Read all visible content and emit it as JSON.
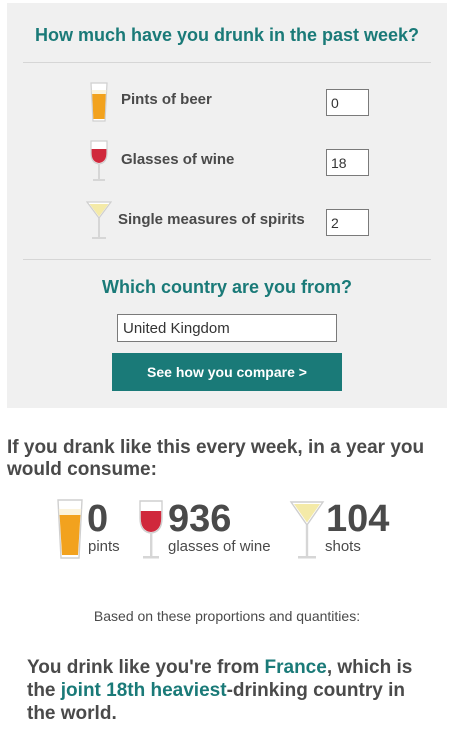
{
  "form": {
    "title": "How much have you drunk in the past week?",
    "rows": [
      {
        "icon": "beer-glass-icon",
        "label": "Pints of beer",
        "value": "0"
      },
      {
        "icon": "wine-glass-icon",
        "label": "Glasses of wine",
        "value": "18"
      },
      {
        "icon": "spirits-glass-icon",
        "label": "Single measures of spirits",
        "value": "2"
      }
    ],
    "country_title": "Which country are you from?",
    "country_value": "United Kingdom",
    "compare_button": "See how you compare >"
  },
  "results": {
    "intro": "If you drank like this every week, in a year you would consume:",
    "stats": [
      {
        "icon": "beer-glass-icon",
        "value": "0",
        "unit": "pints"
      },
      {
        "icon": "wine-glass-icon",
        "value": "936",
        "unit": "glasses of wine"
      },
      {
        "icon": "spirits-glass-icon",
        "value": "104",
        "unit": "shots"
      }
    ],
    "basis_text": "Based on these proportions and quantities:",
    "summary": {
      "part1": "You drink like you're from ",
      "country": "France",
      "part2": ", which is the ",
      "rank": "joint 18th heaviest",
      "part3": "-drinking country in the world."
    }
  },
  "colors": {
    "accent": "#1a7a78",
    "panel_bg": "#f0f0f0",
    "beer": "#f2a21e",
    "wine": "#d0283c",
    "spirits": "#f4eaa8"
  }
}
